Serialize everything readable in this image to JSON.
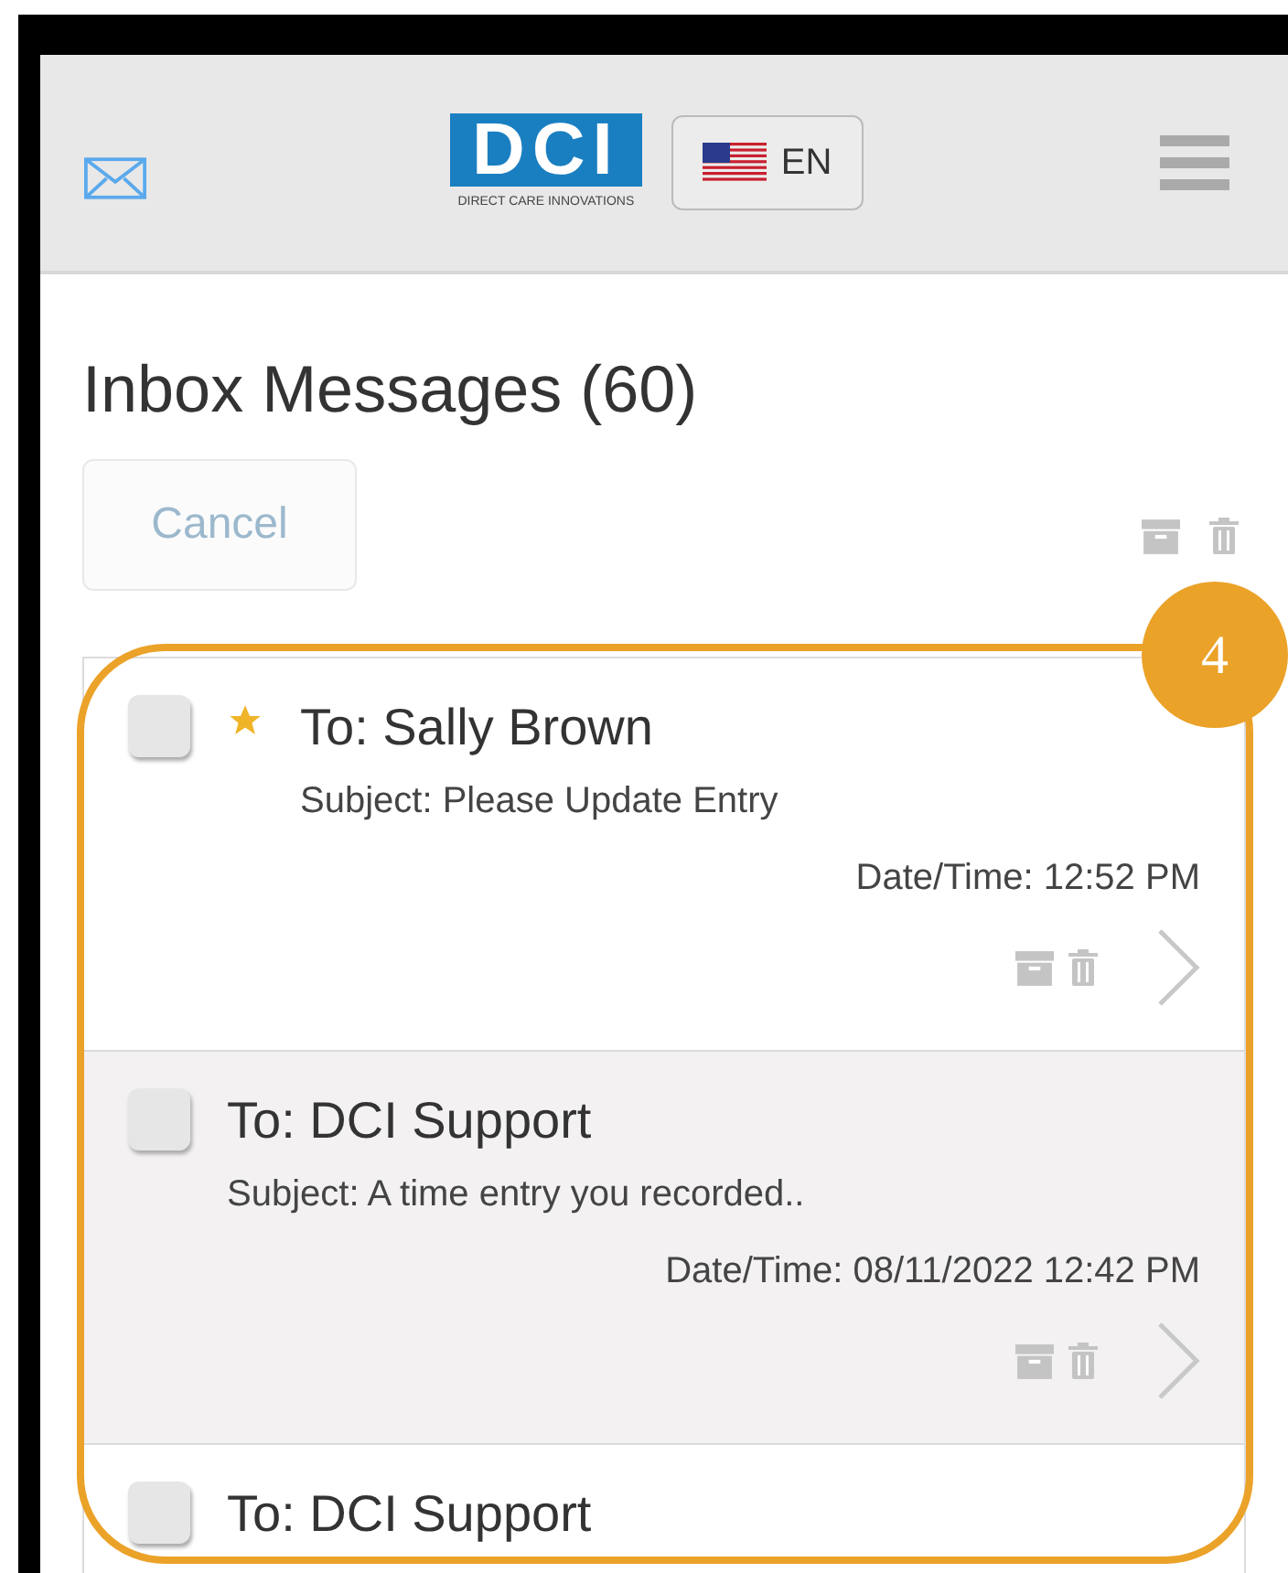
{
  "header": {
    "logo": {
      "mark": "DCI",
      "tagline": "DIRECT CARE INNOVATIONS"
    },
    "language": "EN"
  },
  "title": "Inbox Messages (60)",
  "toolbar": {
    "cancel": "Cancel"
  },
  "messages": [
    {
      "to": "To: Sally Brown",
      "subject": "Subject: Please Update Entry",
      "datetime": "Date/Time: 12:52 PM",
      "checked": false,
      "starred": true,
      "shaded": false
    },
    {
      "to": "To: DCI Support",
      "subject": "Subject: A time entry you recorded..",
      "datetime": "Date/Time: 08/11/2022 12:42 PM",
      "checked": false,
      "starred": false,
      "shaded": true
    },
    {
      "to": "To: DCI Support",
      "checked": false,
      "starred": false,
      "shaded": false
    }
  ],
  "annotation": {
    "label": "4"
  }
}
